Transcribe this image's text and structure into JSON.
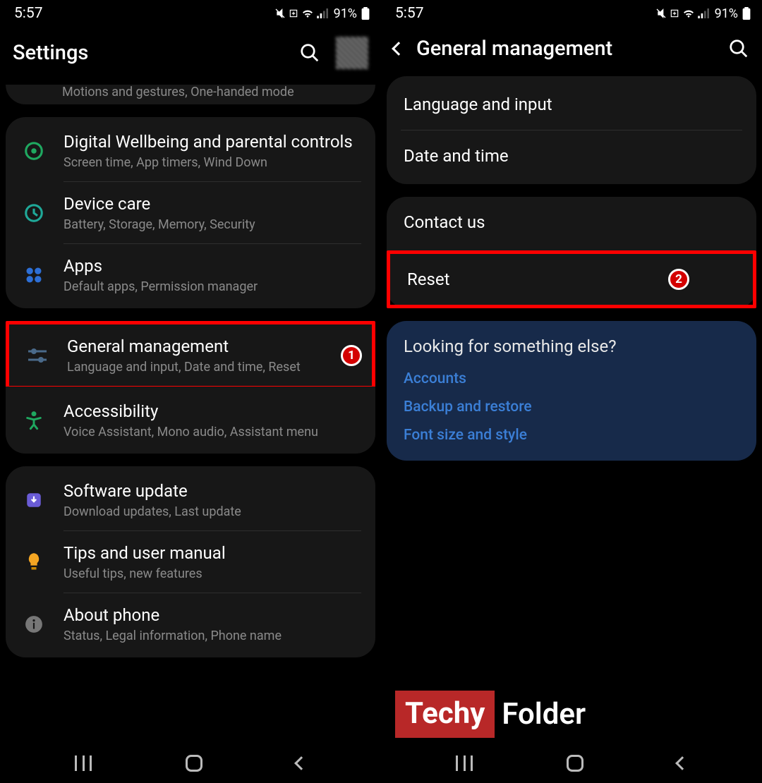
{
  "status": {
    "time": "5:57",
    "battery": "91%"
  },
  "left": {
    "header_title": "Settings",
    "partial_sub": "Motions and gestures, One-handed mode",
    "badge1": "1",
    "items": {
      "wellbeing": {
        "title": "Digital Wellbeing and parental controls",
        "sub": "Screen time, App timers, Wind Down"
      },
      "device_care": {
        "title": "Device care",
        "sub": "Battery, Storage, Memory, Security"
      },
      "apps": {
        "title": "Apps",
        "sub": "Default apps, Permission manager"
      },
      "general": {
        "title": "General management",
        "sub": "Language and input, Date and time, Reset"
      },
      "accessibility": {
        "title": "Accessibility",
        "sub": "Voice Assistant, Mono audio, Assistant menu"
      },
      "software": {
        "title": "Software update",
        "sub": "Download updates, Last update"
      },
      "tips": {
        "title": "Tips and user manual",
        "sub": "Useful tips, new features"
      },
      "about": {
        "title": "About phone",
        "sub": "Status, Legal information, Phone name"
      }
    }
  },
  "right": {
    "header_title": "General management",
    "badge2": "2",
    "items": {
      "lang": "Language and input",
      "date": "Date and time",
      "contact": "Contact us",
      "reset": "Reset"
    },
    "suggest": {
      "title": "Looking for something else?",
      "links": {
        "a": "Accounts",
        "b": "Backup and restore",
        "c": "Font size and style"
      }
    }
  },
  "watermark": {
    "a": "Techy",
    "b": "Folder"
  }
}
